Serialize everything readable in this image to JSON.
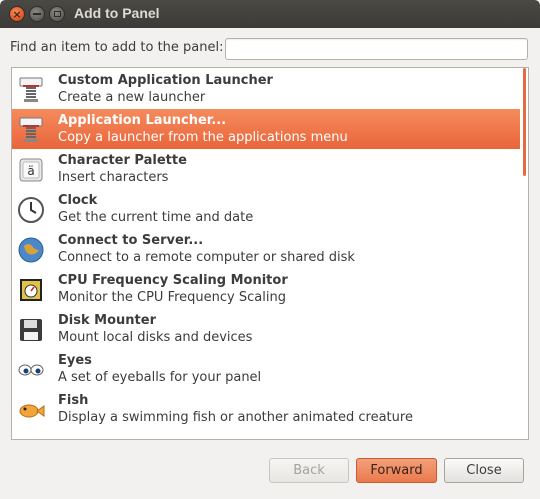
{
  "window": {
    "title": "Add to Panel"
  },
  "search": {
    "label": "Find an item to add to the panel:",
    "value": "",
    "placeholder": ""
  },
  "items": [
    {
      "name": "Custom Application Launcher",
      "desc": "Create a new launcher",
      "icon": "launcher-spring-icon",
      "selected": false
    },
    {
      "name": "Application Launcher...",
      "desc": "Copy a launcher from the applications menu",
      "icon": "launcher-spring-icon",
      "selected": true
    },
    {
      "name": "Character Palette",
      "desc": "Insert characters",
      "icon": "character-palette-icon",
      "selected": false
    },
    {
      "name": "Clock",
      "desc": "Get the current time and date",
      "icon": "clock-icon",
      "selected": false
    },
    {
      "name": "Connect to Server...",
      "desc": "Connect to a remote computer or shared disk",
      "icon": "globe-icon",
      "selected": false
    },
    {
      "name": "CPU Frequency Scaling Monitor",
      "desc": "Monitor the CPU Frequency Scaling",
      "icon": "cpu-gauge-icon",
      "selected": false
    },
    {
      "name": "Disk Mounter",
      "desc": "Mount local disks and devices",
      "icon": "floppy-disk-icon",
      "selected": false
    },
    {
      "name": "Eyes",
      "desc": "A set of eyeballs for your panel",
      "icon": "eyes-icon",
      "selected": false
    },
    {
      "name": "Fish",
      "desc": "Display a swimming fish or another animated creature",
      "icon": "fish-icon",
      "selected": false
    }
  ],
  "buttons": {
    "back": "Back",
    "forward": "Forward",
    "close": "Close"
  },
  "colors": {
    "accent": "#e9653a",
    "titlebar": "#3c3b37",
    "close_button": "#e0531e"
  }
}
